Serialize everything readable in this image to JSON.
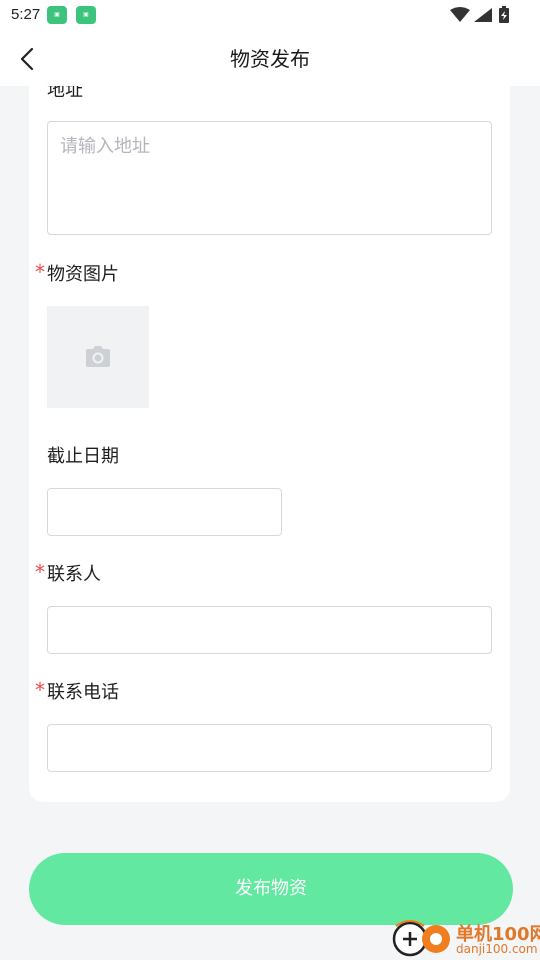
{
  "status_bar": {
    "time": "5:27",
    "app_badges": [
      "app-badge-icon",
      "app-badge-icon"
    ],
    "icons": [
      "wifi-icon",
      "signal-icon",
      "battery-icon"
    ]
  },
  "nav": {
    "title": "物资发布",
    "back_icon": "chevron-left-icon"
  },
  "form": {
    "address": {
      "label": "地址",
      "placeholder": "请输入地址",
      "value": ""
    },
    "images": {
      "label": "物资图片",
      "required": "*",
      "icon": "camera-icon"
    },
    "deadline": {
      "label": "截止日期",
      "value": ""
    },
    "contact_person": {
      "label": "联系人",
      "required": "*",
      "value": ""
    },
    "contact_phone": {
      "label": "联系电话",
      "required": "*",
      "value": ""
    }
  },
  "actions": {
    "publish_label": "发布物资"
  },
  "watermark": {
    "title": "单机100网",
    "subtitle": "danji100.com"
  },
  "colors": {
    "accent": "#62e8a0",
    "required": "#f04a4a",
    "watermark": "#e0782a"
  }
}
